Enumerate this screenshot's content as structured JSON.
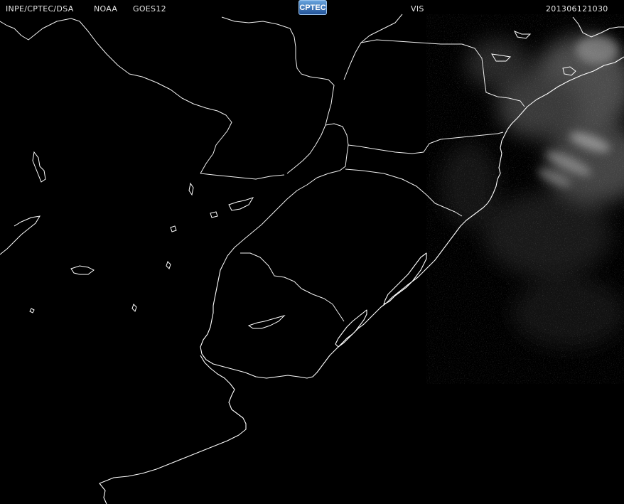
{
  "header": {
    "agency": "INPE/CPTEC/DSA",
    "satellite_org": "NOAA",
    "satellite": "GOES12",
    "logo_text": "CPTEC",
    "channel": "VIS",
    "timestamp": "201306121030"
  },
  "colors": {
    "background": "#000000",
    "outlines": "#ffffff",
    "cloud": "#9a9a9a"
  }
}
